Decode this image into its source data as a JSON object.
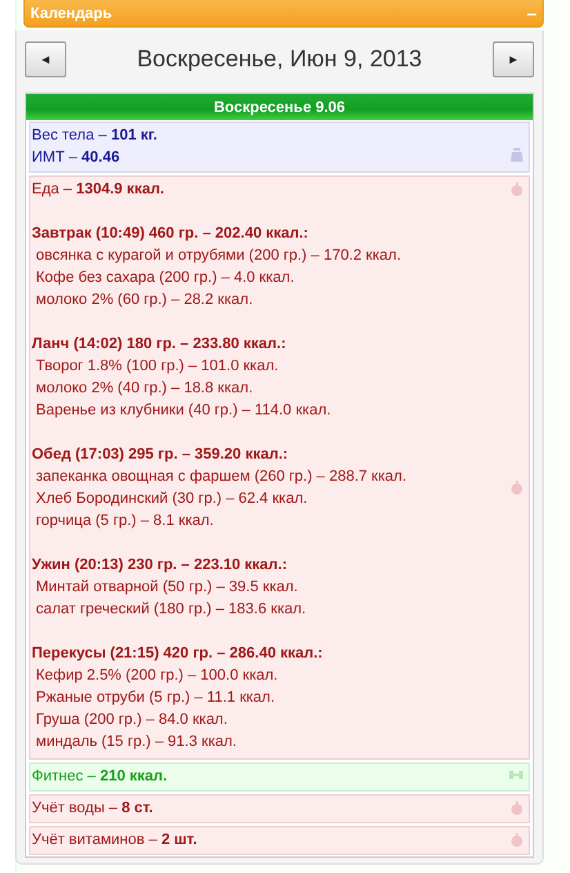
{
  "header": {
    "title": "Календарь",
    "collapse": "–"
  },
  "nav": {
    "prev": "◄",
    "date": "Воскресенье, Июн 9, 2013",
    "next": "►"
  },
  "day": {
    "title": "Воскресенье 9.06"
  },
  "sections": [
    {
      "kind": "weight",
      "lines": [
        "Вес тела – **101 кг.**",
        "ИМТ  – **40.46**"
      ]
    },
    {
      "kind": "food",
      "lines": [
        "Еда – **1304.9 ккал.**"
      ],
      "meals": [
        {
          "title": "Завтрак (10:49) 460 гр. – 202.40 ккал.:",
          "items": [
            "овсянка с курагой и отрубями (200 гр.) – 170.2 ккал.",
            "Кофе без сахара (200 гр.) – 4.0 ккал.",
            "молоко 2% (60 гр.) – 28.2 ккал."
          ]
        },
        {
          "title": "Ланч (14:02) 180 гр. – 233.80 ккал.:",
          "items": [
            "Творог 1.8% (100 гр.) – 101.0 ккал.",
            "молоко 2% (40 гр.) – 18.8 ккал.",
            "Варенье из клубники (40 гр.) – 114.0 ккал."
          ]
        },
        {
          "title": "Обед (17:03) 295 гр. – 359.20 ккал.:",
          "items": [
            "запеканка овощная с фаршем (260 гр.) – 288.7 ккал.",
            "Хлеб Бородинский (30 гр.) – 62.4 ккал.",
            "горчица (5 гр.) – 8.1 ккал."
          ]
        },
        {
          "title": "Ужин (20:13) 230 гр. – 223.10 ккал.:",
          "items": [
            "Минтай отварной (50 гр.) – 39.5 ккал.",
            "салат греческий (180 гр.) – 183.6 ккал."
          ]
        },
        {
          "title": "Перекусы (21:15) 420 гр. – 286.40 ккал.:",
          "items": [
            "Кефир 2.5% (200 гр.) – 100.0 ккал.",
            "Ржаные отруби (5 гр.) – 11.1 ккал.",
            "Груша (200 гр.) – 84.0 ккал.",
            "миндаль (15 гр.) – 91.3 ккал."
          ]
        }
      ]
    },
    {
      "kind": "fitness",
      "lines": [
        "Фитнес  – **210 ккал.**"
      ]
    },
    {
      "kind": "water",
      "lines": [
        "Учёт воды  – **8 ст.**"
      ]
    },
    {
      "kind": "vitamins",
      "lines": [
        "Учёт витаминов  – **2 шт.**"
      ]
    }
  ]
}
